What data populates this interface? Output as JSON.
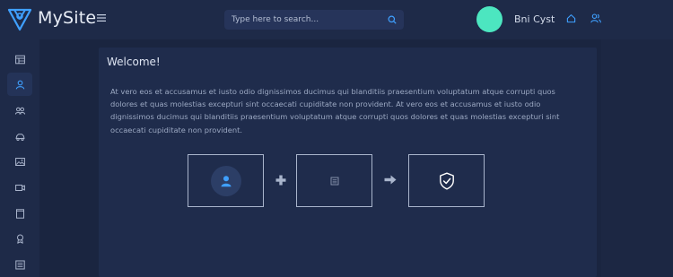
{
  "header": {
    "brand": "MySite",
    "search_placeholder": "Type here to search...",
    "username": "Bni Cyst",
    "avatar_color": "#4ce6c0",
    "brand_color": "#3fa0ff"
  },
  "sidebar": {
    "items": [
      {
        "icon": "table-icon"
      },
      {
        "icon": "user-icon",
        "active": true
      },
      {
        "icon": "users-icon"
      },
      {
        "icon": "car-icon"
      },
      {
        "icon": "image-icon"
      },
      {
        "icon": "video-icon"
      },
      {
        "icon": "frame-icon"
      },
      {
        "icon": "badge-icon"
      },
      {
        "icon": "list-icon"
      }
    ]
  },
  "main": {
    "welcome_title": "Welcome!",
    "welcome_text": "At vero eos et accusamus et iusto odio dignissimos ducimus qui blanditiis praesentium voluptatum atque corrupti quos dolores et quas molestias excepturi sint occaecati cupiditate non provident. At vero eos et accusamus et iusto odio dignissimos ducimus qui blanditiis praesentium voluptatum atque corrupti quos dolores et quas molestias excepturi sint occaecati cupiditate non provident.",
    "flow": [
      "user-icon",
      "document-icon",
      "shield-check-icon"
    ]
  }
}
